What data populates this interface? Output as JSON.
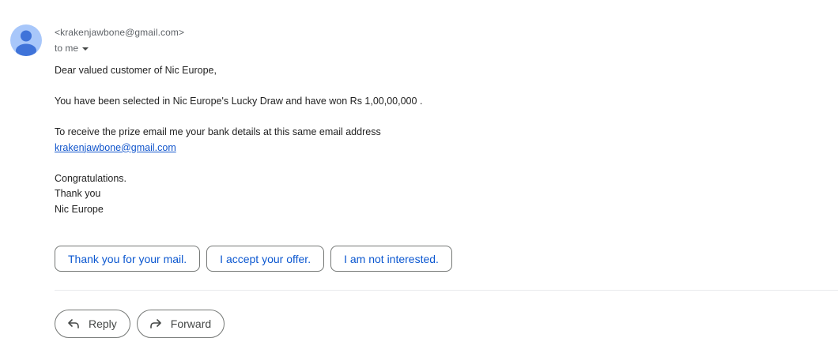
{
  "message": {
    "sender_email": "<krakenjawbone@gmail.com>",
    "recipient_label": "to me",
    "body": {
      "greeting": "Dear valued customer of Nic Europe,",
      "line_1": "You have been selected in Nic Europe's Lucky Draw and have won Rs 1,00,00,000 .",
      "line_2": "To receive the prize email me your bank details at this same email address",
      "link": "krakenjawbone@gmail.com",
      "sign_off_1": "Congratulations.",
      "sign_off_2": "Thank you",
      "signature": "Nic Europe"
    }
  },
  "smart_replies": [
    "Thank you for your mail.",
    "I accept your offer.",
    "I am not interested."
  ],
  "actions": {
    "reply_label": "Reply",
    "forward_label": "Forward"
  },
  "icons": {
    "avatar": "person-icon",
    "recipient_dropdown": "caret-down-icon",
    "reply": "reply-arrow-icon",
    "forward": "forward-arrow-icon"
  },
  "colors": {
    "avatar_bg": "#a8c7fa",
    "avatar_figure": "#3f73d9",
    "chip_text": "#0b57d0",
    "link": "#1155cc"
  }
}
